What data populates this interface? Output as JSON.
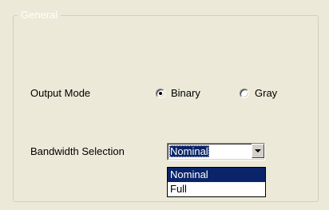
{
  "group": {
    "title": "General"
  },
  "output_mode": {
    "label": "Output Mode",
    "options": [
      {
        "label": "Binary",
        "selected": true
      },
      {
        "label": "Gray",
        "selected": false
      }
    ]
  },
  "bandwidth": {
    "label": "Bandwidth Selection",
    "value": "Nominal",
    "options": [
      "Nominal",
      "Full"
    ],
    "highlighted": "Nominal"
  },
  "colors": {
    "background": "#ECE9D8",
    "selection": "#0A246A"
  }
}
